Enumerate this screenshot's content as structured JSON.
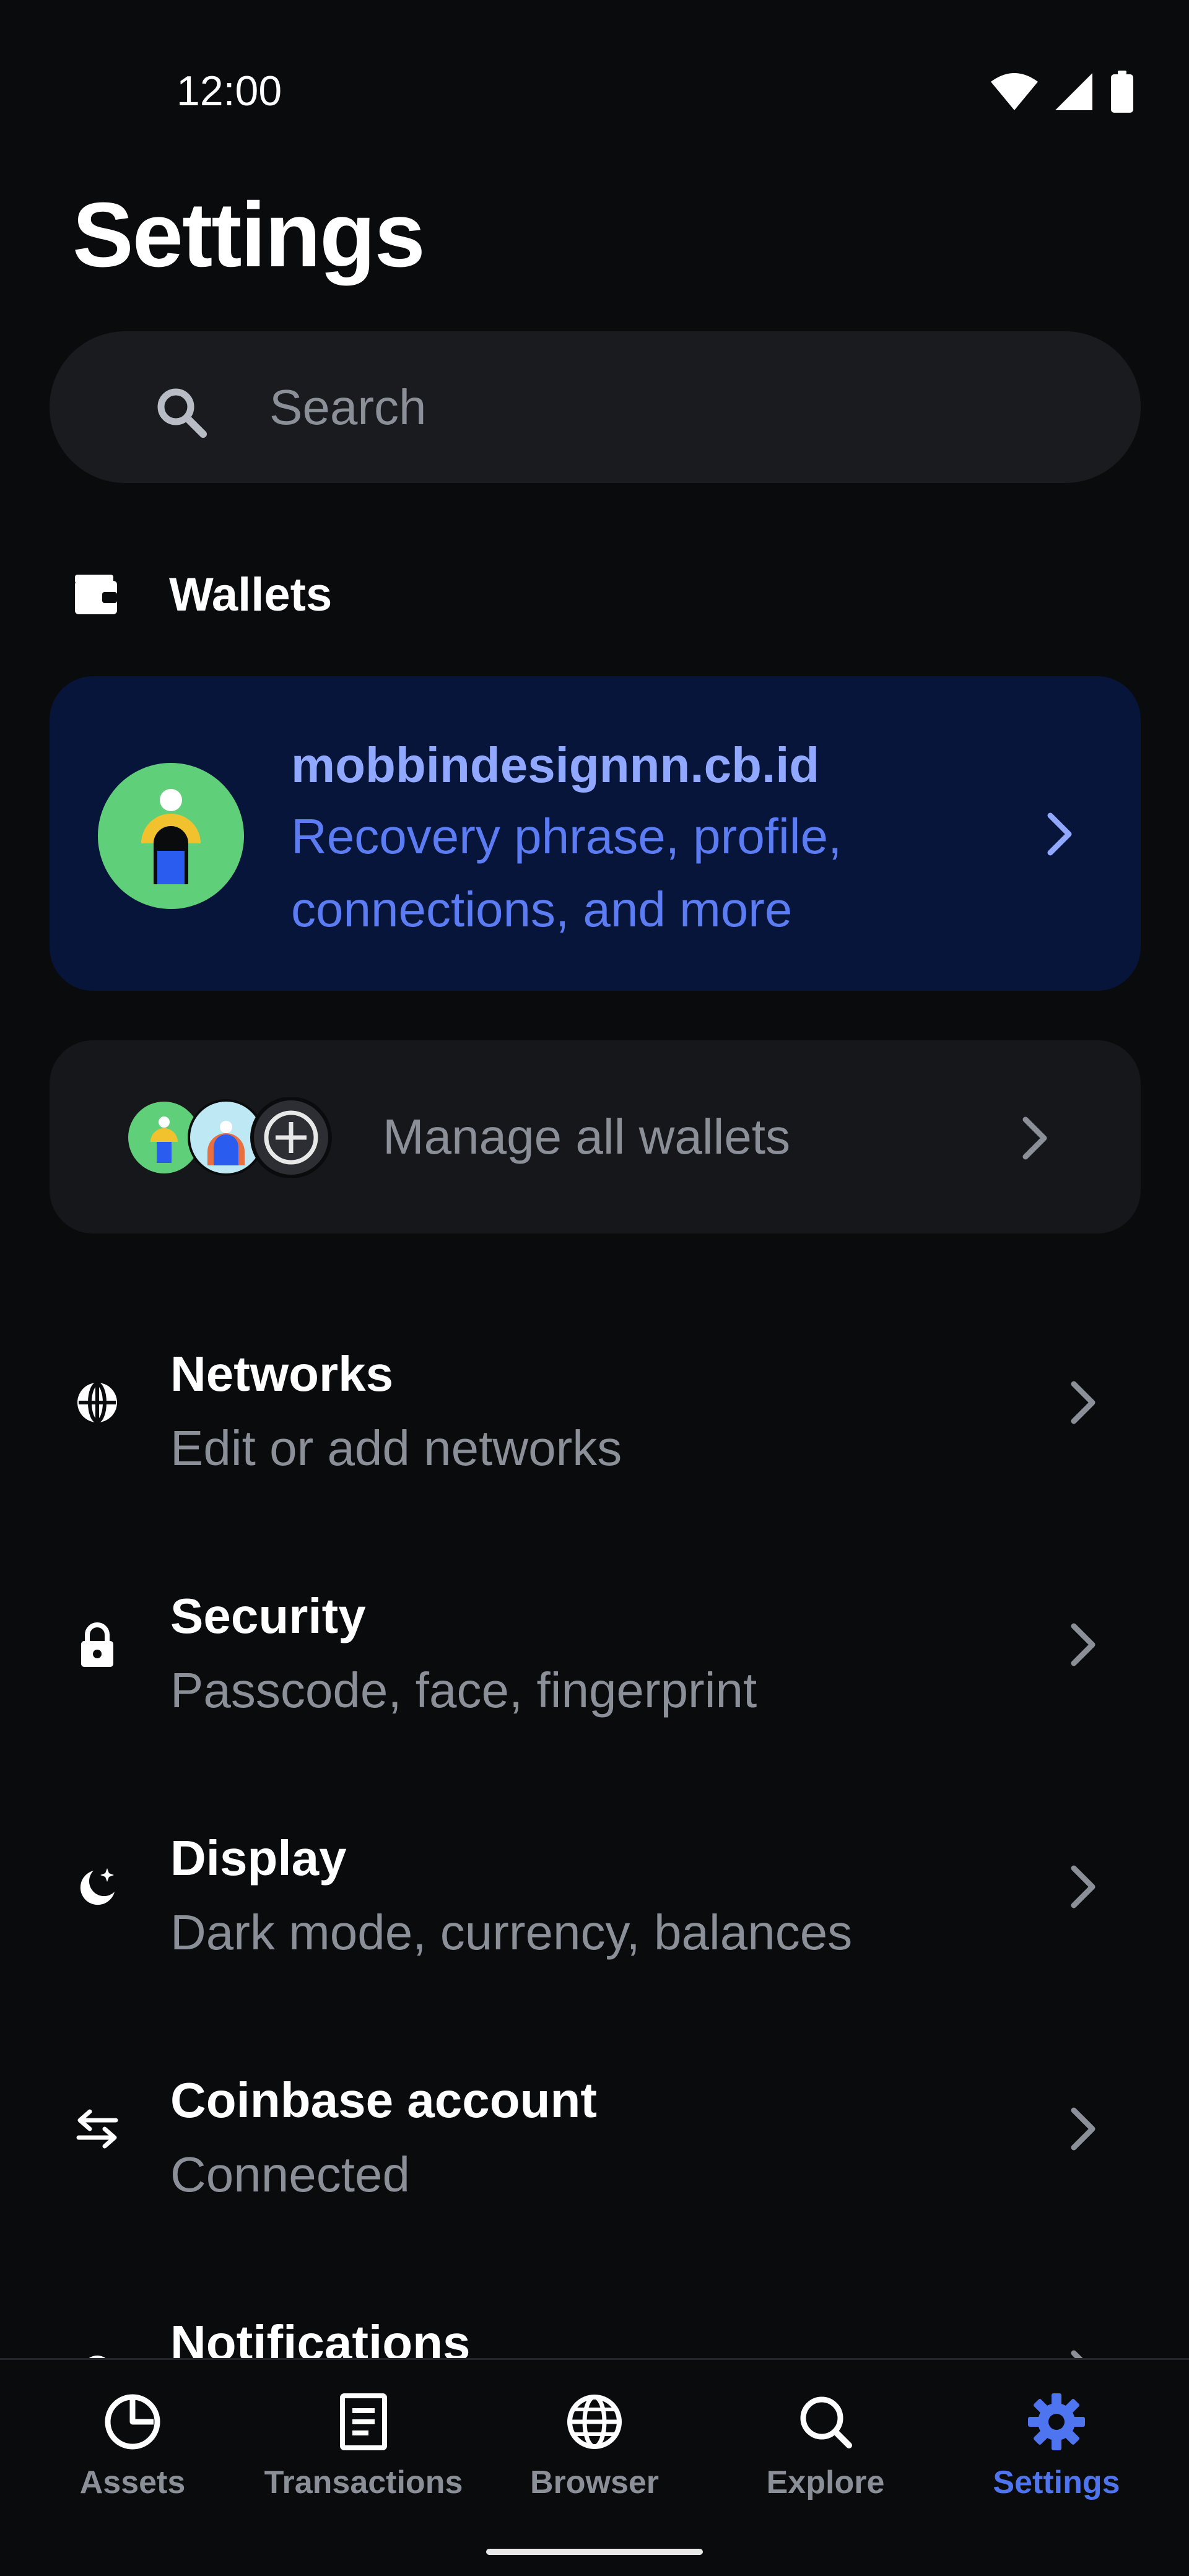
{
  "status_bar": {
    "time": "12:00"
  },
  "page": {
    "title": "Settings"
  },
  "search": {
    "placeholder": "Search"
  },
  "wallets_section": {
    "label": "Wallets"
  },
  "wallet_card": {
    "name": "mobbindesignnn.cb.id",
    "description": "Recovery phrase, profile, connections, and more"
  },
  "manage_wallets": {
    "label": "Manage all wallets"
  },
  "settings_items": [
    {
      "title": "Networks",
      "subtitle": "Edit or add networks",
      "icon": "globe-icon"
    },
    {
      "title": "Security",
      "subtitle": "Passcode, face, fingerprint",
      "icon": "lock-icon"
    },
    {
      "title": "Display",
      "subtitle": "Dark mode, currency, balances",
      "icon": "moon-icon"
    },
    {
      "title": "Coinbase account",
      "subtitle": "Connected",
      "icon": "swap-arrows-icon"
    },
    {
      "title": "Notifications",
      "subtitle": "",
      "icon": "bell-icon"
    }
  ],
  "bottom_nav": {
    "items": [
      {
        "label": "Assets",
        "icon": "pie-chart-icon"
      },
      {
        "label": "Transactions",
        "icon": "receipt-icon"
      },
      {
        "label": "Browser",
        "icon": "globe-icon"
      },
      {
        "label": "Explore",
        "icon": "search-icon"
      },
      {
        "label": "Settings",
        "icon": "gear-icon",
        "active": true
      }
    ]
  },
  "colors": {
    "background": "#0a0b0d",
    "accent": "#4f74ef",
    "wallet_card": "#07153a",
    "muted_text": "#8a8f98"
  }
}
